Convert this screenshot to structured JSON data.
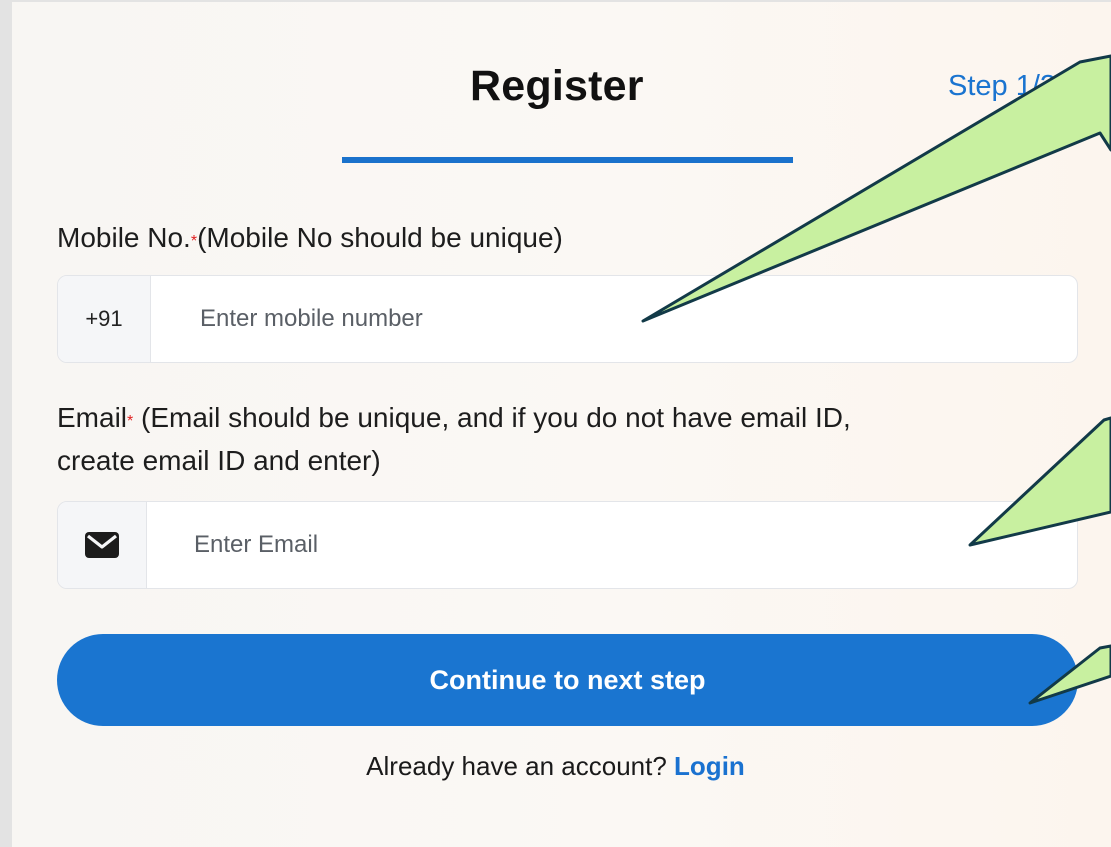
{
  "header": {
    "title": "Register",
    "step": "Step 1/2"
  },
  "mobile": {
    "label_main": "Mobile No.",
    "required_mark": "*",
    "label_note": "(Mobile No should be unique)",
    "prefix": "+91",
    "placeholder": "Enter mobile number",
    "value": ""
  },
  "email": {
    "label_main": "Email",
    "required_mark": "*",
    "label_note": " (Email should be unique, and if you do not have email ID,",
    "label_note_line2": "create email ID and enter)",
    "prefix_icon": "envelope-icon",
    "placeholder": "Enter Email",
    "value": ""
  },
  "continue_button": {
    "label": "Continue to next step"
  },
  "footer": {
    "prompt": "Already have an account? ",
    "login_link": "Login"
  },
  "colors": {
    "accent": "#1a75d0",
    "callout_fill": "#c8f0a0",
    "callout_stroke": "#123a48",
    "required": "#e02020"
  }
}
